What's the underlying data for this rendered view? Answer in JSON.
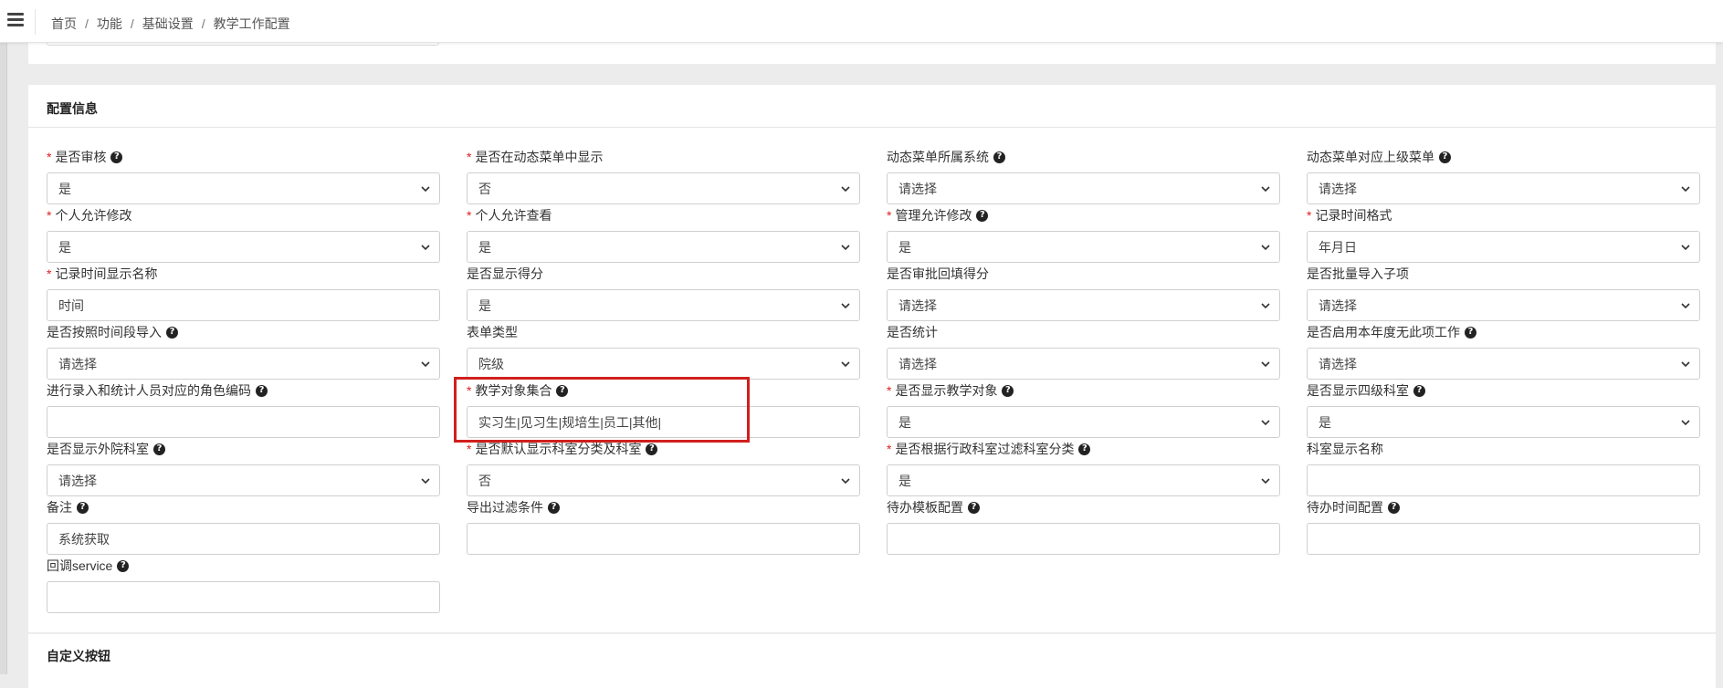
{
  "breadcrumb": [
    "首页",
    "功能",
    "基础设置",
    "教学工作配置"
  ],
  "breadcrumb_sep": "/",
  "section_title": "配置信息",
  "section2_title": "自定义按钮",
  "fields": [
    {
      "label": "是否审核",
      "required": true,
      "help": true,
      "type": "select",
      "value": "是"
    },
    {
      "label": "是否在动态菜单中显示",
      "required": true,
      "help": false,
      "type": "select",
      "value": "否"
    },
    {
      "label": "动态菜单所属系统",
      "required": false,
      "help": true,
      "type": "select",
      "value": "请选择"
    },
    {
      "label": "动态菜单对应上级菜单",
      "required": false,
      "help": true,
      "type": "select",
      "value": "请选择"
    },
    {
      "label": "个人允许修改",
      "required": true,
      "help": false,
      "type": "select",
      "value": "是"
    },
    {
      "label": "个人允许查看",
      "required": true,
      "help": false,
      "type": "select",
      "value": "是"
    },
    {
      "label": "管理允许修改",
      "required": true,
      "help": true,
      "type": "select",
      "value": "是"
    },
    {
      "label": "记录时间格式",
      "required": true,
      "help": false,
      "type": "select",
      "value": "年月日"
    },
    {
      "label": "记录时间显示名称",
      "required": true,
      "help": false,
      "type": "text",
      "value": "时间"
    },
    {
      "label": "是否显示得分",
      "required": false,
      "help": false,
      "type": "select",
      "value": "是"
    },
    {
      "label": "是否审批回填得分",
      "required": false,
      "help": false,
      "type": "select",
      "value": "请选择"
    },
    {
      "label": "是否批量导入子项",
      "required": false,
      "help": false,
      "type": "select",
      "value": "请选择"
    },
    {
      "label": "是否按照时间段导入",
      "required": false,
      "help": true,
      "type": "select",
      "value": "请选择"
    },
    {
      "label": "表单类型",
      "required": false,
      "help": false,
      "type": "select",
      "value": "院级"
    },
    {
      "label": "是否统计",
      "required": false,
      "help": false,
      "type": "select",
      "value": "请选择"
    },
    {
      "label": "是否启用本年度无此项工作",
      "required": false,
      "help": true,
      "type": "select",
      "value": "请选择"
    },
    {
      "label": "进行录入和统计人员对应的角色编码",
      "required": false,
      "help": true,
      "type": "text",
      "value": ""
    },
    {
      "label": "教学对象集合",
      "required": true,
      "help": true,
      "type": "text",
      "value": "实习生|见习生|规培生|员工|其他|"
    },
    {
      "label": "是否显示教学对象",
      "required": true,
      "help": true,
      "type": "select",
      "value": "是"
    },
    {
      "label": "是否显示四级科室",
      "required": false,
      "help": true,
      "type": "select",
      "value": "是"
    },
    {
      "label": "是否显示外院科室",
      "required": false,
      "help": true,
      "type": "select",
      "value": "请选择"
    },
    {
      "label": "是否默认显示科室分类及科室",
      "required": true,
      "help": true,
      "type": "select",
      "value": "否"
    },
    {
      "label": "是否根据行政科室过滤科室分类",
      "required": true,
      "help": true,
      "type": "select",
      "value": "是"
    },
    {
      "label": "科室显示名称",
      "required": false,
      "help": false,
      "type": "text",
      "value": ""
    },
    {
      "label": "备注",
      "required": false,
      "help": true,
      "type": "text",
      "value": "系统获取"
    },
    {
      "label": "导出过滤条件",
      "required": false,
      "help": true,
      "type": "text",
      "value": ""
    },
    {
      "label": "待办模板配置",
      "required": false,
      "help": true,
      "type": "text",
      "value": ""
    },
    {
      "label": "待办时间配置",
      "required": false,
      "help": true,
      "type": "text",
      "value": ""
    },
    {
      "label": "回调service",
      "required": false,
      "help": true,
      "type": "text",
      "value": ""
    }
  ],
  "help_glyph": "?",
  "required_mark": "*",
  "colors": {
    "required": "#e02020",
    "highlight_border": "#d0201d"
  },
  "icons": {
    "menu": "hamburger-icon",
    "help": "question-circle-icon",
    "select_caret": "chevron-down-icon"
  }
}
